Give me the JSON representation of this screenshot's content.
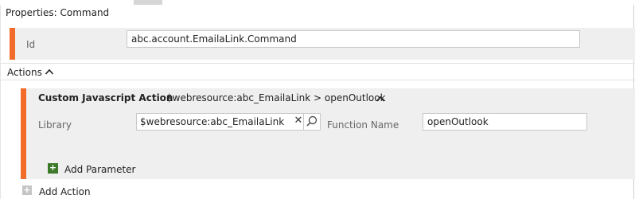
{
  "panel": {
    "title": "Properties: Command"
  },
  "id_row": {
    "label": "Id",
    "value": "abc.account.EmailaLink.Command"
  },
  "actions": {
    "header_label": "Actions",
    "items": [
      {
        "title": "Custom Javascript Action",
        "resource": "$webresource:abc_EmailaLink > openOutlook",
        "library_label": "Library",
        "library_value": "$webresource:abc_EmailaLink",
        "function_label": "Function Name",
        "function_value": "openOutlook",
        "add_parameter_label": "Add Parameter"
      }
    ],
    "add_action_label": "Add Action"
  },
  "icons": {
    "collapse": "chevron-up-icon",
    "clear": "close-icon",
    "lookup": "search-icon",
    "add_parameter": "plus-icon",
    "add_action": "plus-icon"
  },
  "colors": {
    "accent": "#f26b2a",
    "add_green": "#3c7a2a"
  }
}
